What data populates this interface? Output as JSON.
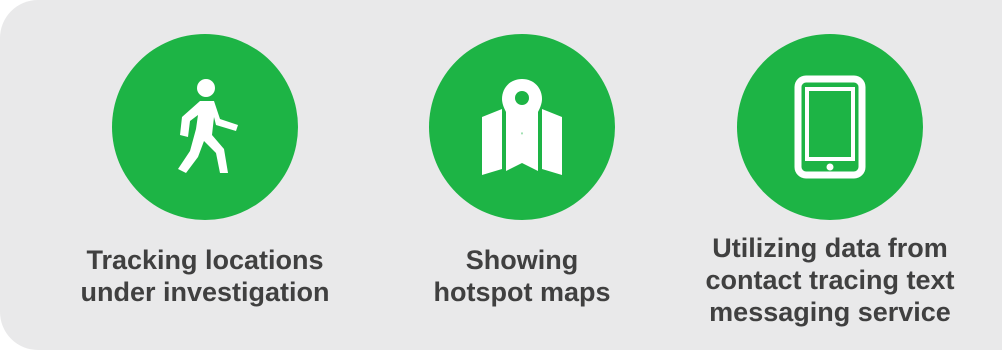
{
  "panel": {
    "background": "#e9e9ea",
    "accent": "#1db445",
    "text_color": "#404040"
  },
  "items": [
    {
      "icon": "walking-person-icon",
      "label": "Tracking locations\nunder investigation"
    },
    {
      "icon": "map-pin-icon",
      "label": "Showing\nhotspot maps"
    },
    {
      "icon": "tablet-icon",
      "label": "Utilizing data from\ncontact tracing text\nmessaging service"
    }
  ]
}
